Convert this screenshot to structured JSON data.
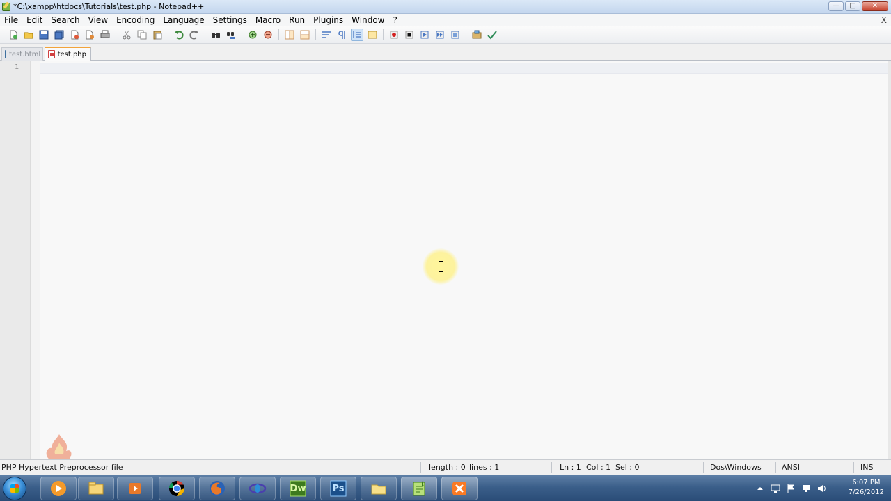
{
  "window": {
    "title": "*C:\\xampp\\htdocs\\Tutorials\\test.php - Notepad++",
    "minimize_glyph": "—",
    "maximize_glyph": "□",
    "close_glyph": "✕"
  },
  "menu": {
    "items": [
      "File",
      "Edit",
      "Search",
      "View",
      "Encoding",
      "Language",
      "Settings",
      "Macro",
      "Run",
      "Plugins",
      "Window",
      "?"
    ],
    "close_glyph": "X"
  },
  "toolbar": {
    "icons": [
      "new-file-icon",
      "open-file-icon",
      "save-icon",
      "save-all-icon",
      "close-icon",
      "close-all-icon",
      "print-icon",
      "cut-icon",
      "copy-icon",
      "paste-icon",
      "undo-icon",
      "redo-icon",
      "find-icon",
      "replace-icon",
      "zoom-in-icon",
      "zoom-out-icon",
      "sync-vertical-icon",
      "sync-horizontal-icon",
      "word-wrap-icon",
      "show-all-chars-icon",
      "indent-guide-icon",
      "user-lang-icon",
      "record-macro-icon",
      "stop-macro-icon",
      "play-macro-icon",
      "run-macro-multiple-icon",
      "save-macro-icon",
      "spell-check-icon"
    ]
  },
  "tabs": [
    {
      "label": "test.html",
      "active": false
    },
    {
      "label": "test.php",
      "active": true
    }
  ],
  "editor": {
    "line_numbers": [
      "1"
    ],
    "content": ""
  },
  "statusbar": {
    "file_type": "PHP Hypertext Preprocessor file",
    "length": "length : 0",
    "lines": "lines : 1",
    "ln": "Ln : 1",
    "col": "Col : 1",
    "sel": "Sel : 0",
    "eol": "Dos\\Windows",
    "encoding": "ANSI",
    "mode": "INS"
  },
  "taskbar": {
    "apps": [
      "media-player-icon",
      "file-explorer-icon",
      "media-center-icon",
      "chrome-icon",
      "firefox-icon",
      "app-icon",
      "dreamweaver-icon",
      "photoshop-icon",
      "folder-icon",
      "notepad-plus-plus-icon",
      "xampp-icon"
    ],
    "dreamweaver_label": "Dw",
    "photoshop_label": "Ps",
    "clock_time": "6:07 PM",
    "clock_date": "7/26/2012"
  },
  "colors": {
    "accent_tab": "#f2a33a",
    "taskbar": "#3b5f8a",
    "editor_bg": "#f8f8f8"
  }
}
